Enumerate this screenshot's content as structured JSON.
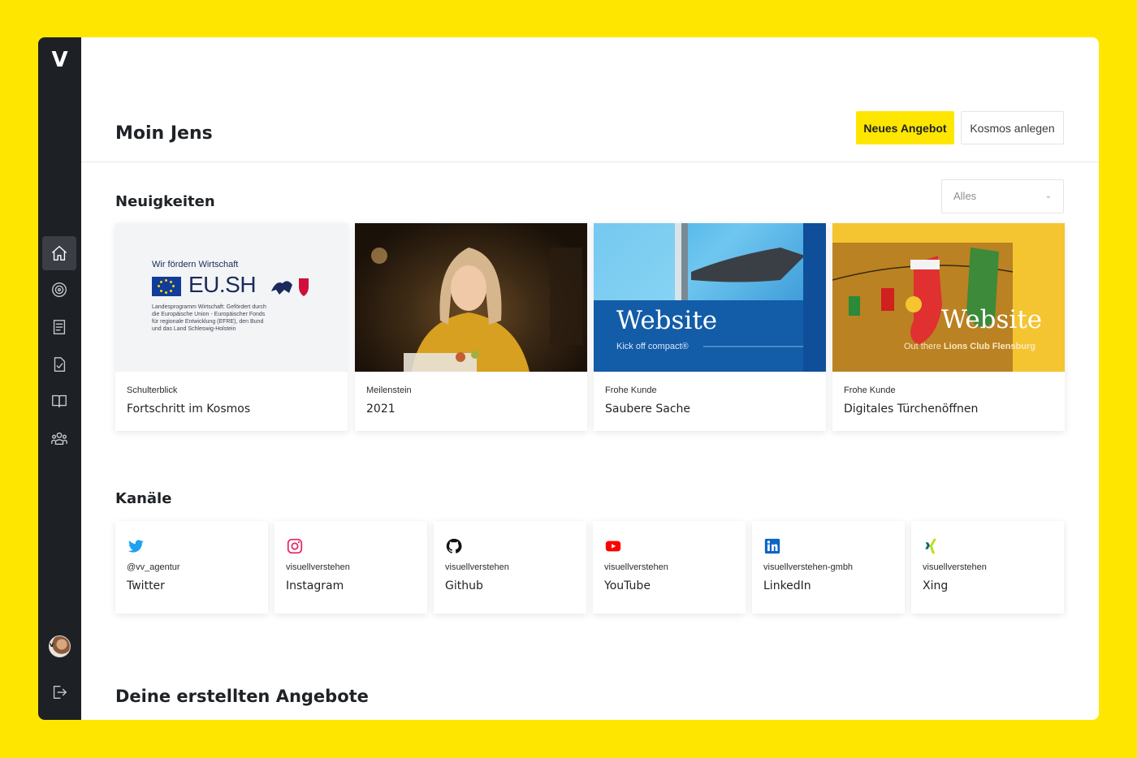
{
  "brand": {
    "logo": "V",
    "accent": "#FFE600",
    "sidebar_bg": "#1d2024"
  },
  "sidebar": {
    "items": [
      {
        "icon": "home-icon",
        "active": true
      },
      {
        "icon": "target-icon",
        "active": false
      },
      {
        "icon": "document-icon",
        "active": false
      },
      {
        "icon": "checklist-icon",
        "active": false
      },
      {
        "icon": "book-icon",
        "active": false
      },
      {
        "icon": "team-icon",
        "active": false
      }
    ],
    "avatar_label": "v",
    "logout_icon": "logout-icon"
  },
  "header": {
    "greeting": "Moin Jens",
    "primary_button": "Neues Angebot",
    "secondary_button": "Kosmos anlegen"
  },
  "news": {
    "title": "Neuigkeiten",
    "filter": "Alles",
    "cards": [
      {
        "tag": "Schulterblick",
        "title": "Fortschritt im Kosmos"
      },
      {
        "tag": "Meilenstein",
        "title": "2021"
      },
      {
        "tag": "Frohe Kunde",
        "title": "Saubere Sache"
      },
      {
        "tag": "Frohe Kunde",
        "title": "Digitales Türchenöffnen"
      }
    ],
    "eu_image": {
      "headline": "Wir fördern Wirtschaft",
      "logo_text": "EU.SH",
      "lines": [
        "Landesprogramm Wirtschaft: Gefördert durch",
        "die Europäische Union - Europäischer Fonds",
        "für regionale Entwicklung (EFRE), den Bund",
        "und das Land Schleswig-Holstein"
      ]
    },
    "window_image": {
      "word": "Website",
      "sub": "Kick off compact®"
    },
    "xmas_image": {
      "word": "Website",
      "sub_prefix": "Out there ",
      "sub_bold": "Lions Club Flensburg"
    }
  },
  "channels": {
    "title": "Kanäle",
    "items": [
      {
        "icon": "twitter-icon",
        "handle": "@vv_agentur",
        "name": "Twitter",
        "color": "#1DA1F2"
      },
      {
        "icon": "instagram-icon",
        "handle": "visuellverstehen",
        "name": "Instagram",
        "color": "#E1306C"
      },
      {
        "icon": "github-icon",
        "handle": "visuellverstehen",
        "name": "Github",
        "color": "#111111"
      },
      {
        "icon": "youtube-icon",
        "handle": "visuellverstehen",
        "name": "YouTube",
        "color": "#FF0000"
      },
      {
        "icon": "linkedin-icon",
        "handle": "visuellverstehen-gmbh",
        "name": "LinkedIn",
        "color": "#0A66C2"
      },
      {
        "icon": "xing-icon",
        "handle": "visuellverstehen",
        "name": "Xing",
        "color": "#026466"
      }
    ]
  },
  "offers": {
    "title": "Deine erstellten Angebote"
  }
}
